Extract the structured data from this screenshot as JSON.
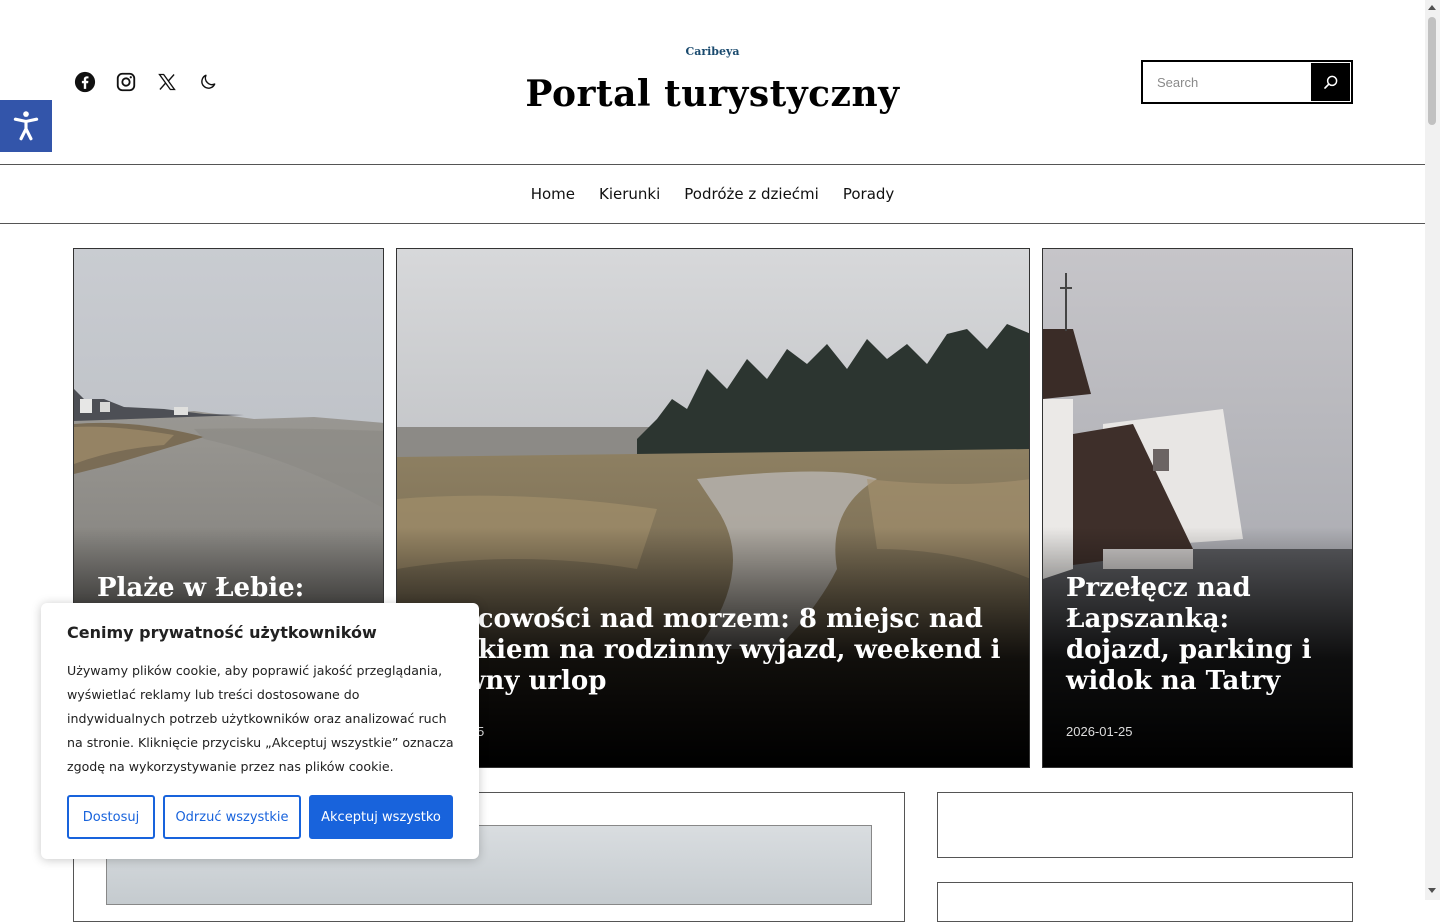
{
  "header": {
    "brand_small": "Caribeya",
    "site_title": "Portal turystyczny",
    "social_icons": [
      "facebook-icon",
      "instagram-icon",
      "x-icon",
      "moon-icon"
    ],
    "search": {
      "placeholder": "Search",
      "icon": "search-icon"
    }
  },
  "accessibility": {
    "icon": "accessibility-icon"
  },
  "nav": {
    "items": [
      {
        "label": "Home"
      },
      {
        "label": "Kierunki"
      },
      {
        "label": "Podróże z dziećmi"
      },
      {
        "label": "Porady"
      }
    ]
  },
  "featured": [
    {
      "title": "Plaże w Łebie:",
      "date": ""
    },
    {
      "title": "Miejscowości nad morzem: 8 miejsc nad Bałtykiem na rodzinny wyjazd, weekend i dłuższy urlop",
      "visible_title": "scowości nad morzem: 8 miejsc nad\nykiem na rodzinny wyjazd, weekend i\nwny urlop",
      "date_fragment": "5"
    },
    {
      "title": "Przełęcz nad Łapszanką: dojazd, parking i widok na Tatry",
      "date": "2026-01-25"
    }
  ],
  "cookie_banner": {
    "title": "Cenimy prywatność użytkowników",
    "text": "Używamy plików cookie, aby poprawić jakość przeglądania, wyświetlać reklamy lub treści dostosowane do indywidualnych potrzeb użytkowników oraz analizować ruch na stronie. Kliknięcie przycisku „Akceptuj wszystkie” oznacza zgodę na wykorzystywanie przez nas plików cookie.",
    "buttons": {
      "customize": "Dostosuj",
      "reject": "Odrzuć wszystkie",
      "accept": "Akceptuj wszystko"
    }
  },
  "colors": {
    "accent": "#1863dc",
    "accessibility": "#3355aa",
    "brand_small": "#1a4a6e"
  }
}
